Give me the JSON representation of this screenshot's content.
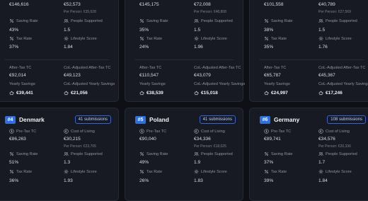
{
  "cards": [
    {
      "pre_tax_tc": "€146,616",
      "cost_of_living": "€52,573",
      "cost_per_person": "Per Person: €35,628",
      "saving_rate_label": "Saving Rate",
      "saving_rate": "43%",
      "people_label": "People Supported",
      "people": "1.5",
      "tax_rate_label": "Tax Rate",
      "tax_rate": "37%",
      "lifestyle_label": "Lifestyle Score",
      "lifestyle": "1.84",
      "after_tax_label": "After-Tax TC",
      "after_tax": "€92,014",
      "col_adj_label": "CoL-Adjusted After-Tax TC",
      "col_adj": "€49,123",
      "yearly_label": "Yearly Savings",
      "yearly": "€39,441",
      "col_yearly_label": "CoL-Adjusted Yearly Savings",
      "col_yearly": "€21,056"
    },
    {
      "pre_tax_tc": "€145,175",
      "cost_of_living": "€72,008",
      "cost_per_person": "Per Person: €48,808",
      "saving_rate_label": "Saving Rate",
      "saving_rate": "35%",
      "people_label": "People Supported",
      "people": "1.5",
      "tax_rate_label": "Tax Rate",
      "tax_rate": "24%",
      "lifestyle_label": "Lifestyle Score",
      "lifestyle": "1.96",
      "after_tax_label": "After-Tax TC",
      "after_tax": "€110,547",
      "col_adj_label": "CoL-Adjusted After-Tax TC",
      "col_adj": "€43,079",
      "yearly_label": "Yearly Savings",
      "yearly": "€38,539",
      "col_yearly_label": "CoL-Adjusted Yearly Savings",
      "col_yearly": "€15,018"
    },
    {
      "pre_tax_tc": "€101,558",
      "cost_of_living": "€40,789",
      "cost_per_person": "Per Person: €27,569",
      "saving_rate_label": "Saving Rate",
      "saving_rate": "38%",
      "people_label": "People Supported",
      "people": "1.5",
      "tax_rate_label": "Tax Rate",
      "tax_rate": "35%",
      "lifestyle_label": "Lifestyle Score",
      "lifestyle": "1.76",
      "after_tax_label": "After-Tax TC",
      "after_tax": "€65,787",
      "col_adj_label": "CoL-Adjusted After-Tax TC",
      "col_adj": "€45,367",
      "yearly_label": "Yearly Savings",
      "yearly": "€24,997",
      "col_yearly_label": "CoL-Adjusted Yearly Savings",
      "col_yearly": "€17,246"
    },
    {
      "rank": "#4",
      "country": "Denmark",
      "submissions": "41 submissions",
      "pre_tax_label": "Pre-Tax TC",
      "pre_tax_tc": "€86,263",
      "cost_label": "Cost of Living",
      "cost_of_living": "€30,215",
      "cost_per_person": "Per Person: €23,705",
      "saving_rate_label": "Saving Rate",
      "saving_rate": "51%",
      "people_label": "People Supported",
      "people": "1.3",
      "tax_rate_label": "Tax Rate",
      "tax_rate": "36%",
      "lifestyle_label": "Lifestyle Score",
      "lifestyle": "1.93"
    },
    {
      "rank": "#5",
      "country": "Poland",
      "submissions": "41 submissions",
      "pre_tax_label": "Pre-Tax TC",
      "pre_tax_tc": "€90,040",
      "cost_label": "Cost of Living",
      "cost_of_living": "€34,336",
      "cost_per_person": "Per Person: €18,025",
      "saving_rate_label": "Saving Rate",
      "saving_rate": "49%",
      "people_label": "People Supported",
      "people": "1.9",
      "tax_rate_label": "Tax Rate",
      "tax_rate": "26%",
      "lifestyle_label": "Lifestyle Score",
      "lifestyle": "1.83"
    },
    {
      "rank": "#6",
      "country": "Germany",
      "submissions": "108 submissions",
      "pre_tax_label": "Pre-Tax TC",
      "pre_tax_tc": "€89,741",
      "cost_label": "Cost of Living",
      "cost_of_living": "€34,576",
      "cost_per_person": "Per Person: €20,336",
      "saving_rate_label": "Saving Rate",
      "saving_rate": "37%",
      "people_label": "People Supported",
      "people": "1.7",
      "tax_rate_label": "Tax Rate",
      "tax_rate": "39%",
      "lifestyle_label": "Lifestyle Score",
      "lifestyle": "1.84"
    }
  ],
  "colors": {
    "rank_badge": "#2f6fe0",
    "card_bg": "#171a22",
    "page_bg": "#0e1015"
  },
  "icons": {
    "pre_tax": "dollar-circle-icon",
    "cost": "euro-circle-icon",
    "saving": "percent-icon",
    "people": "people-icon",
    "tax": "percent-icon",
    "lifestyle": "gear-icon",
    "savings": "piggy-bank-icon"
  }
}
